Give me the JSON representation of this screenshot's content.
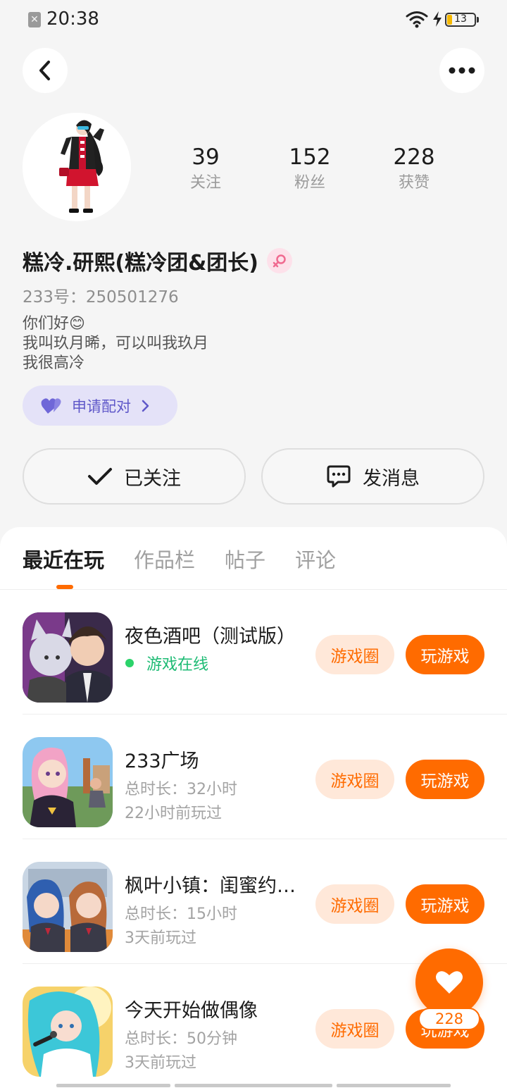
{
  "status_bar": {
    "time": "20:38",
    "battery": "13",
    "sim_glyph": "✕"
  },
  "profile": {
    "stats": [
      {
        "value": "39",
        "label": "关注"
      },
      {
        "value": "152",
        "label": "粉丝"
      },
      {
        "value": "228",
        "label": "获赞"
      }
    ],
    "nickname": "糕冷.研熙(糕冷团&团长)",
    "uid": "233号：250501276",
    "bio": [
      "你们好😊",
      "我叫玖月晞，可以叫我玖月",
      "我很高冷"
    ],
    "match_label": "申请配对",
    "follow_label": "已关注",
    "message_label": "发消息"
  },
  "tabs": [
    "最近在玩",
    "作品栏",
    "帖子",
    "评论"
  ],
  "games": [
    {
      "name": "夜色酒吧（测试版）",
      "status": "游戏在线",
      "circle": "游戏圈",
      "play": "玩游戏"
    },
    {
      "name": "233广场",
      "duration": "总时长：32小时",
      "last_played": "22小时前玩过",
      "circle": "游戏圈",
      "play": "玩游戏"
    },
    {
      "name": "枫叶小镇：闺蜜约…",
      "duration": "总时长：15小时",
      "last_played": "3天前玩过",
      "circle": "游戏圈",
      "play": "玩游戏"
    },
    {
      "name": "今天开始做偶像",
      "duration": "总时长：50分钟",
      "last_played": "3天前玩过",
      "circle": "游戏圈",
      "play": "玩游戏"
    }
  ],
  "like": {
    "count": "228"
  },
  "colors": {
    "accent": "#ff6b00",
    "online": "#1dbb74",
    "match": "#5f58c9"
  }
}
